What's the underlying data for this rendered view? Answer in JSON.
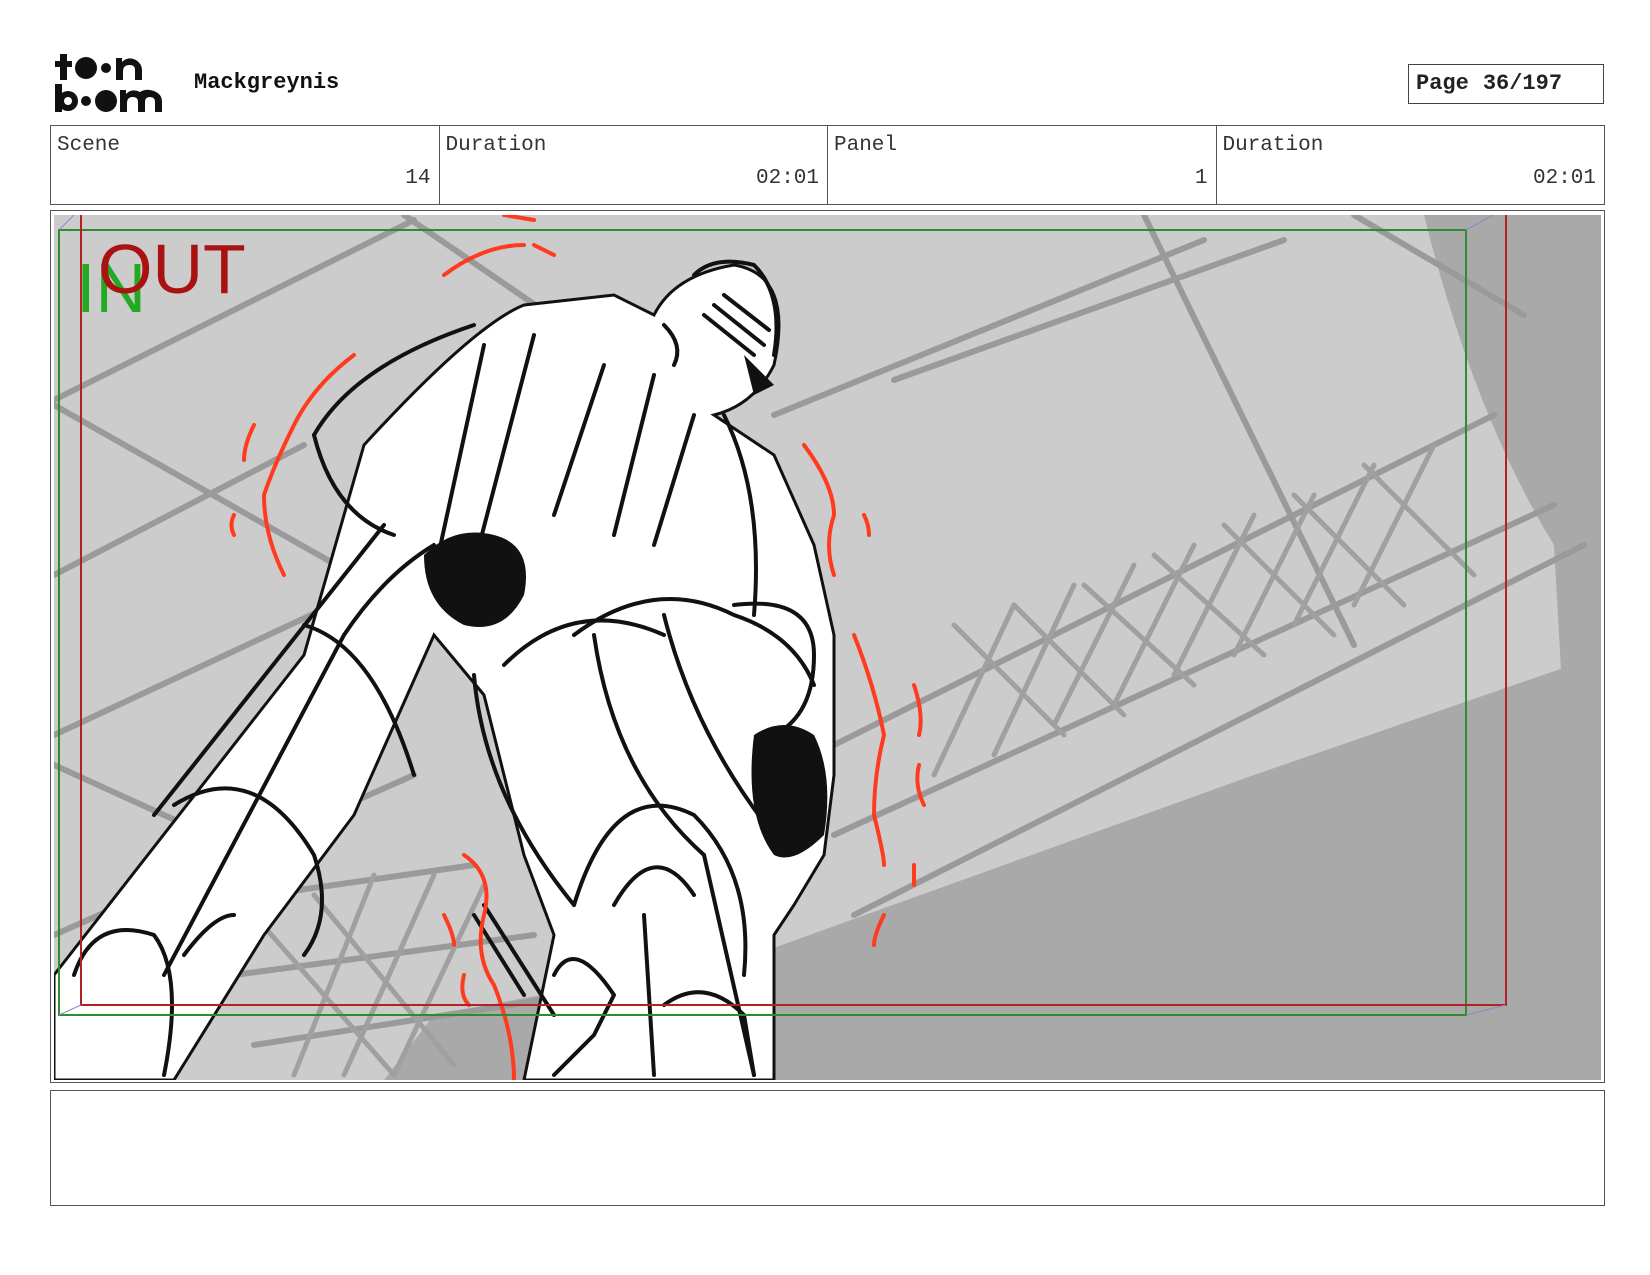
{
  "header": {
    "logo_text": "toon boom",
    "project_title": "Mackgreynis",
    "page_label": "Page",
    "page_number": "36/197"
  },
  "info": {
    "scene_label": "Scene",
    "scene_value": "14",
    "scene_duration_label": "Duration",
    "scene_duration_value": "02:01",
    "panel_label": "Panel",
    "panel_value": "1",
    "panel_duration_label": "Duration",
    "panel_duration_value": "02:01"
  },
  "panel": {
    "in_marker": "IN",
    "out_marker": "OUT",
    "colors": {
      "background": "#cccccc",
      "shadow": "#a9a9a9",
      "ink": "#111111",
      "effect_lines": "#ff3b1f",
      "in_frame": "#2e8b2e",
      "out_frame": "#b22222"
    }
  },
  "notes": {
    "text": ""
  }
}
